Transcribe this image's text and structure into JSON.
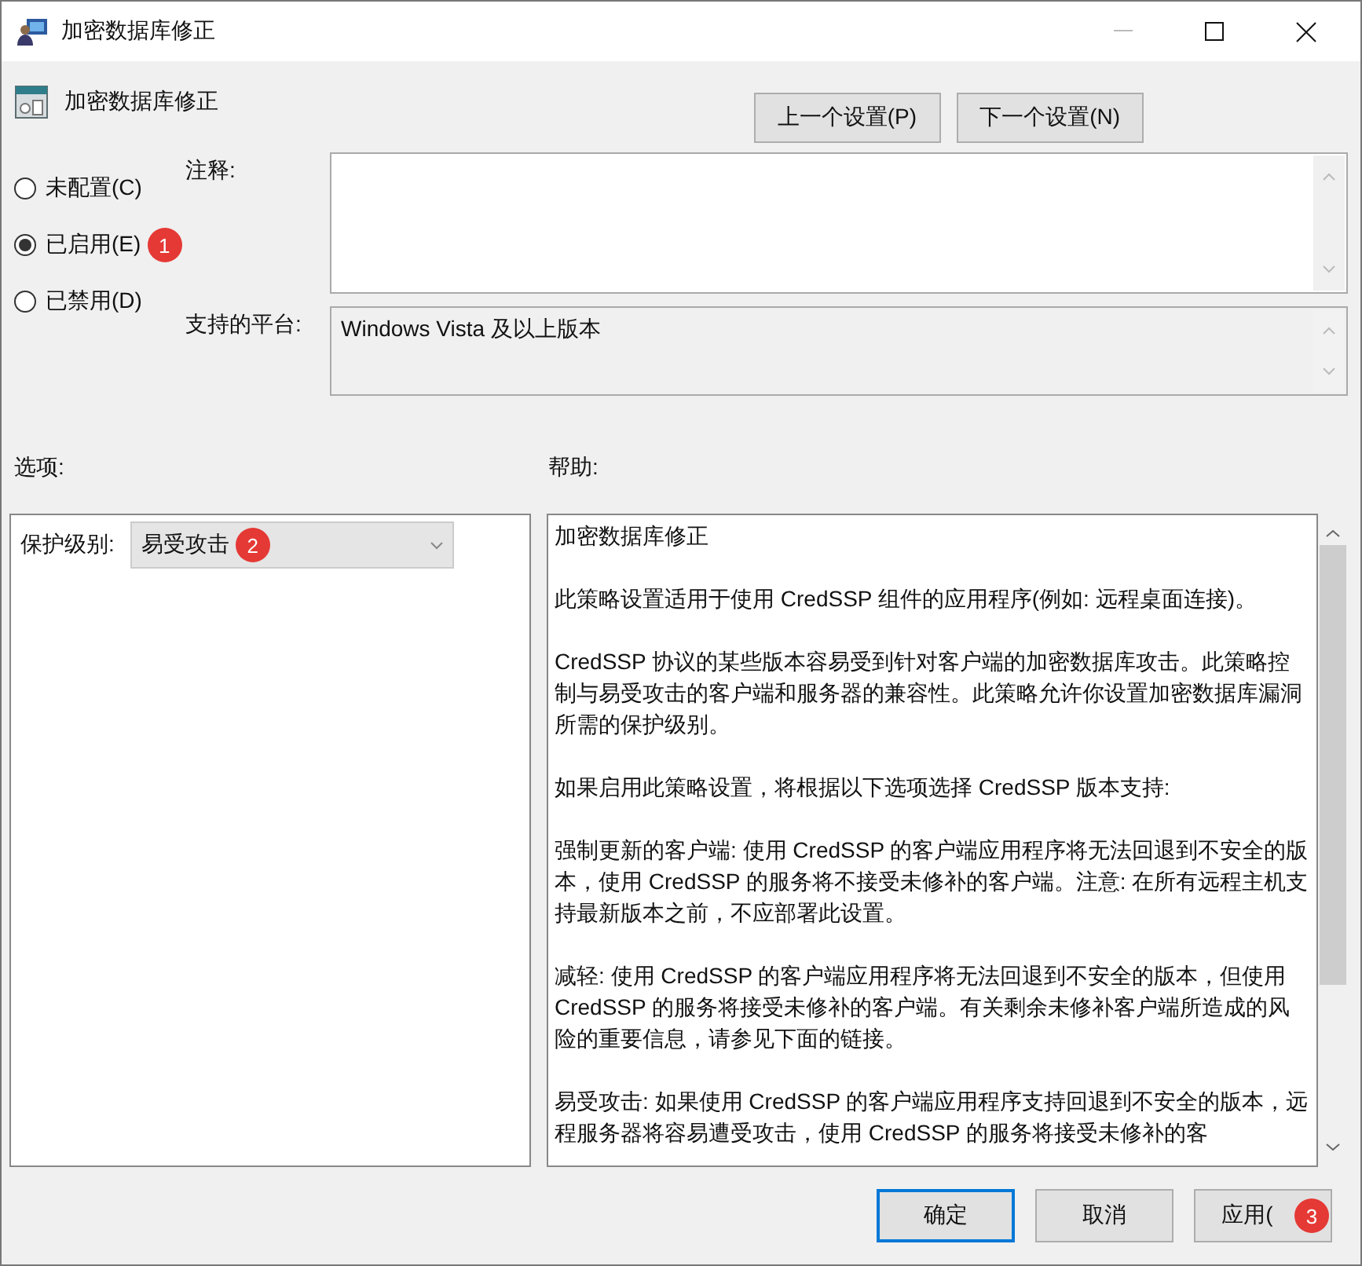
{
  "window": {
    "title": "加密数据库修正"
  },
  "header": {
    "title": "加密数据库修正"
  },
  "nav_buttons": [
    {
      "label": "上一个设置(P)"
    },
    {
      "label": "下一个设置(N)"
    }
  ],
  "state_options": [
    {
      "label": "未配置(C)",
      "selected": false
    },
    {
      "label": "已启用(E)",
      "selected": true,
      "badge": "1"
    },
    {
      "label": "已禁用(D)",
      "selected": false
    }
  ],
  "comment": {
    "label": "注释:"
  },
  "platform": {
    "label": "支持的平台:",
    "value": "Windows Vista 及以上版本"
  },
  "options_label": "选项:",
  "help_label": "帮助:",
  "protection": {
    "label": "保护级别:",
    "value": "易受攻击",
    "badge": "2"
  },
  "help_paragraphs": [
    "加密数据库修正",
    "此策略设置适用于使用 CredSSP 组件的应用程序(例如: 远程桌面连接)。",
    "CredSSP 协议的某些版本容易受到针对客户端的加密数据库攻击。此策略控制与易受攻击的客户端和服务器的兼容性。此策略允许你设置加密数据库漏洞所需的保护级别。",
    "如果启用此策略设置，将根据以下选项选择 CredSSP 版本支持:",
    "强制更新的客户端: 使用 CredSSP 的客户端应用程序将无法回退到不安全的版本，使用 CredSSP 的服务将不接受未修补的客户端。注意: 在所有远程主机支持最新版本之前，不应部署此设置。",
    "减轻: 使用 CredSSP 的客户端应用程序将无法回退到不安全的版本，但使用 CredSSP 的服务将接受未修补的客户端。有关剩余未修补客户端所造成的风险的重要信息，请参见下面的链接。",
    "易受攻击: 如果使用 CredSSP 的客户端应用程序支持回退到不安全的版本，远程服务器将容易遭受攻击，使用 CredSSP 的服务将接受未修补的客"
  ],
  "footer_buttons": [
    {
      "label": "确定",
      "default": true
    },
    {
      "label": "取消",
      "default": false
    },
    {
      "label": "应用(",
      "default": false,
      "badge": "3"
    }
  ]
}
